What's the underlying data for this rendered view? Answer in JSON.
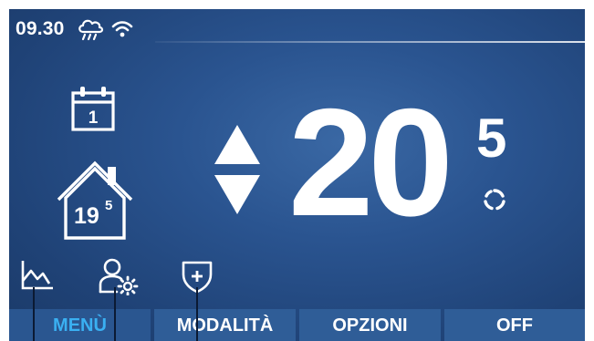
{
  "status": {
    "time": "09.30",
    "weather_icon": "rain-cloud-icon",
    "wifi_icon": "wifi-icon"
  },
  "calendar": {
    "day": "1"
  },
  "house": {
    "temp_integer": "19",
    "temp_decimal": "5"
  },
  "setpoint": {
    "integer": "20",
    "decimal": "5"
  },
  "bottom_icons": [
    "graph-icon",
    "user-settings-icon",
    "shield-plus-icon"
  ],
  "tabs": [
    {
      "label": "MENÙ",
      "active": true
    },
    {
      "label": "MODALITÀ",
      "active": false
    },
    {
      "label": "OPZIONI",
      "active": false
    },
    {
      "label": "OFF",
      "active": false
    }
  ],
  "colors": {
    "background": "#2a5490",
    "active_tab_text": "#3ab0f2",
    "tab_background": "#2f5d97",
    "text": "#ffffff"
  }
}
